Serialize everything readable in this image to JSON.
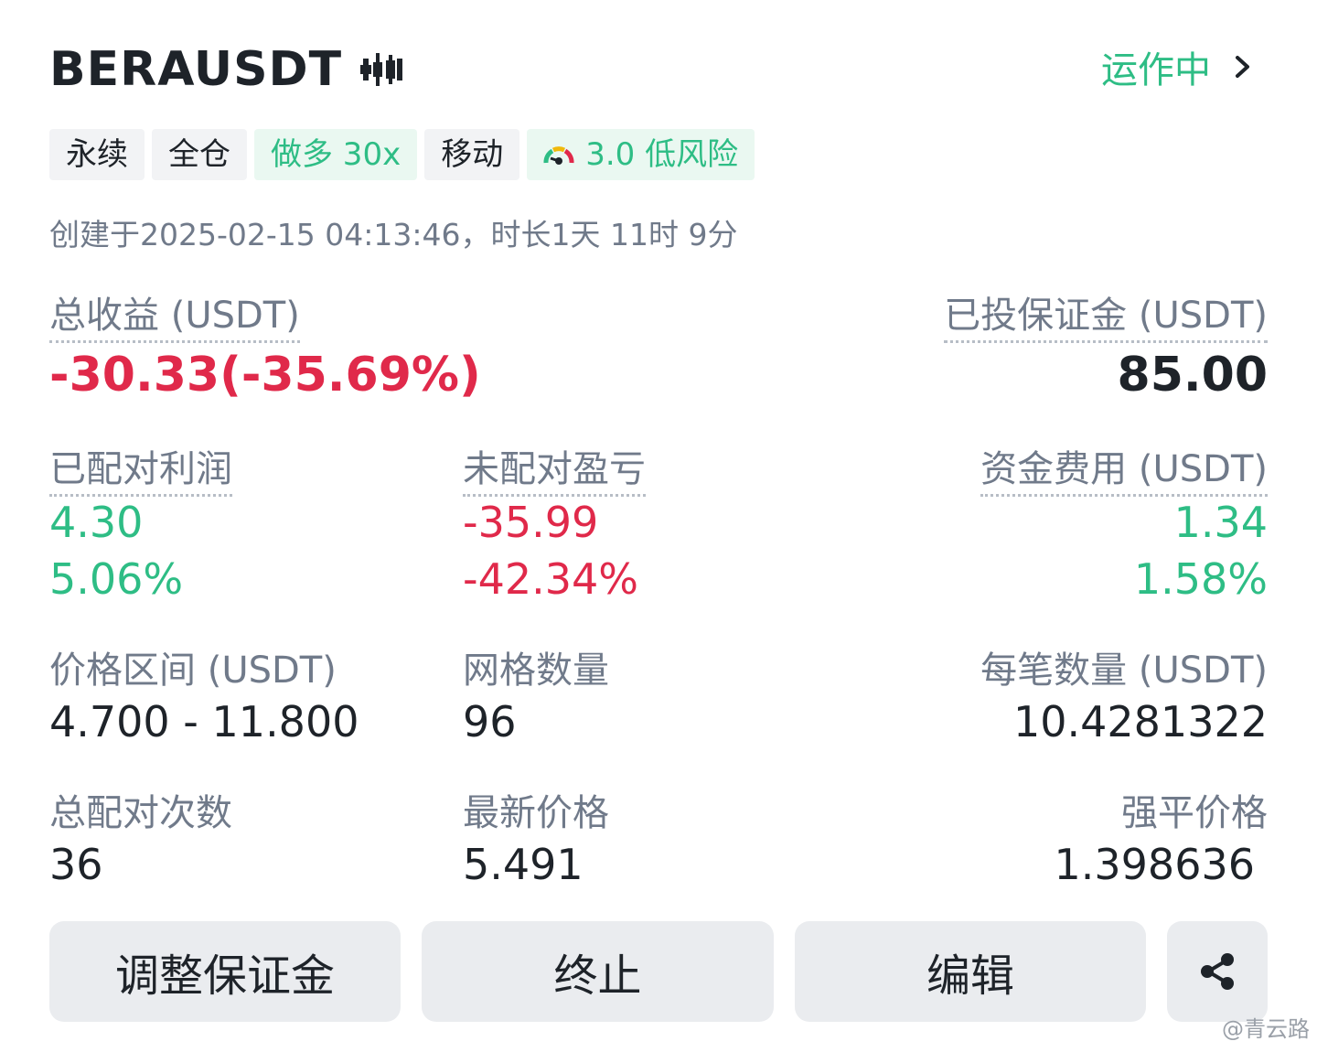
{
  "header": {
    "symbol": "BERAUSDT",
    "status": "运作中"
  },
  "tags": {
    "perpetual": "永续",
    "margin_mode": "全仓",
    "direction": "做多 30x",
    "type": "移动",
    "risk": "3.0 低风险"
  },
  "created": "创建于2025-02-15 04:13:46，时长1天 11时 9分",
  "total_pnl": {
    "label": "总收益 (USDT)",
    "value": "-30.33(-35.69%)"
  },
  "invested_margin": {
    "label": "已投保证金 (USDT)",
    "value": "85.00"
  },
  "matched_profit": {
    "label": "已配对利润",
    "amount": "4.30",
    "percent": "5.06%"
  },
  "unmatched_pnl": {
    "label": "未配对盈亏",
    "amount": "-35.99",
    "percent": "-42.34%"
  },
  "funding_fee": {
    "label": "资金费用 (USDT)",
    "amount": "1.34",
    "percent": "1.58%"
  },
  "price_range": {
    "label": "价格区间 (USDT)",
    "value": "4.700 - 11.800"
  },
  "grid_count": {
    "label": "网格数量",
    "value": "96"
  },
  "per_order": {
    "label": "每笔数量 (USDT)",
    "value": "10.4281322"
  },
  "total_matches": {
    "label": "总配对次数",
    "value": "36"
  },
  "last_price": {
    "label": "最新价格",
    "value": "5.491"
  },
  "liq_price": {
    "label": "强平价格",
    "value": "1.398636"
  },
  "buttons": {
    "adjust_margin": "调整保证金",
    "stop": "终止",
    "edit": "编辑"
  },
  "icons": {
    "grid": "grid-bot-icon",
    "chevron": "chevron-right-icon",
    "risk": "risk-gauge-icon",
    "share": "share-icon"
  },
  "colors": {
    "green": "#2ebd85",
    "red": "#e0294a",
    "text": "#1e2329",
    "muted": "#707a8a"
  },
  "watermark": "@青云路"
}
